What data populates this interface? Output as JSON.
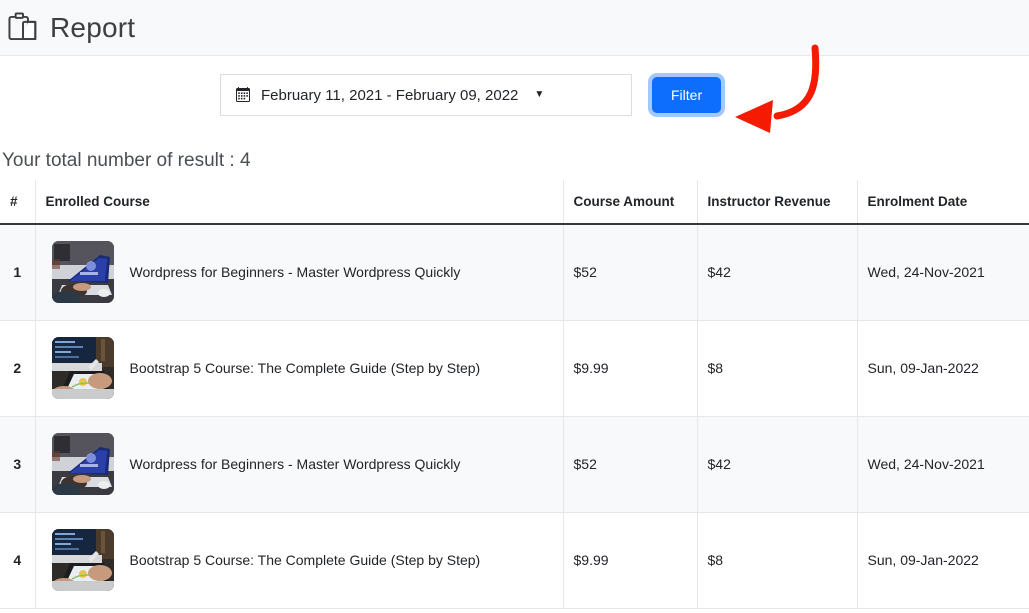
{
  "header": {
    "title": "Report",
    "icon": "clipboard-icon"
  },
  "filter_bar": {
    "calendar_icon": "calendar-icon",
    "date_range": "February 11, 2021 - February 09, 2022",
    "caret": "▼",
    "filter_button_label": "Filter",
    "annotation": "red-curved-arrow pointing to Filter button"
  },
  "summary": {
    "result_count_text": "Your total number of result : 4"
  },
  "table": {
    "columns": [
      "#",
      "Enrolled Course",
      "Course Amount",
      "Instructor Revenue",
      "Enrolment Date"
    ],
    "rows": [
      {
        "index": "1",
        "course": "Wordpress for Beginners - Master Wordpress Quickly",
        "thumb": "laptop-blue-screen-thumbnail",
        "amount": "$52",
        "revenue": "$42",
        "date": "Wed, 24-Nov-2021"
      },
      {
        "index": "2",
        "course": "Bootstrap 5 Course: The Complete Guide (Step by Step)",
        "thumb": "tablet-stylus-thumbnail",
        "amount": "$9.99",
        "revenue": "$8",
        "date": "Sun, 09-Jan-2022"
      },
      {
        "index": "3",
        "course": "Wordpress for Beginners - Master Wordpress Quickly",
        "thumb": "laptop-blue-screen-thumbnail",
        "amount": "$52",
        "revenue": "$42",
        "date": "Wed, 24-Nov-2021"
      },
      {
        "index": "4",
        "course": "Bootstrap 5 Course: The Complete Guide (Step by Step)",
        "thumb": "tablet-stylus-thumbnail",
        "amount": "$9.99",
        "revenue": "$8",
        "date": "Sun, 09-Jan-2022"
      }
    ]
  },
  "colors": {
    "primary": "#0d6efd",
    "header_band": "#f8f9fa",
    "annotation_red": "#f51b02",
    "stripe": "#f8f9fa",
    "border": "#e6e7e9"
  }
}
